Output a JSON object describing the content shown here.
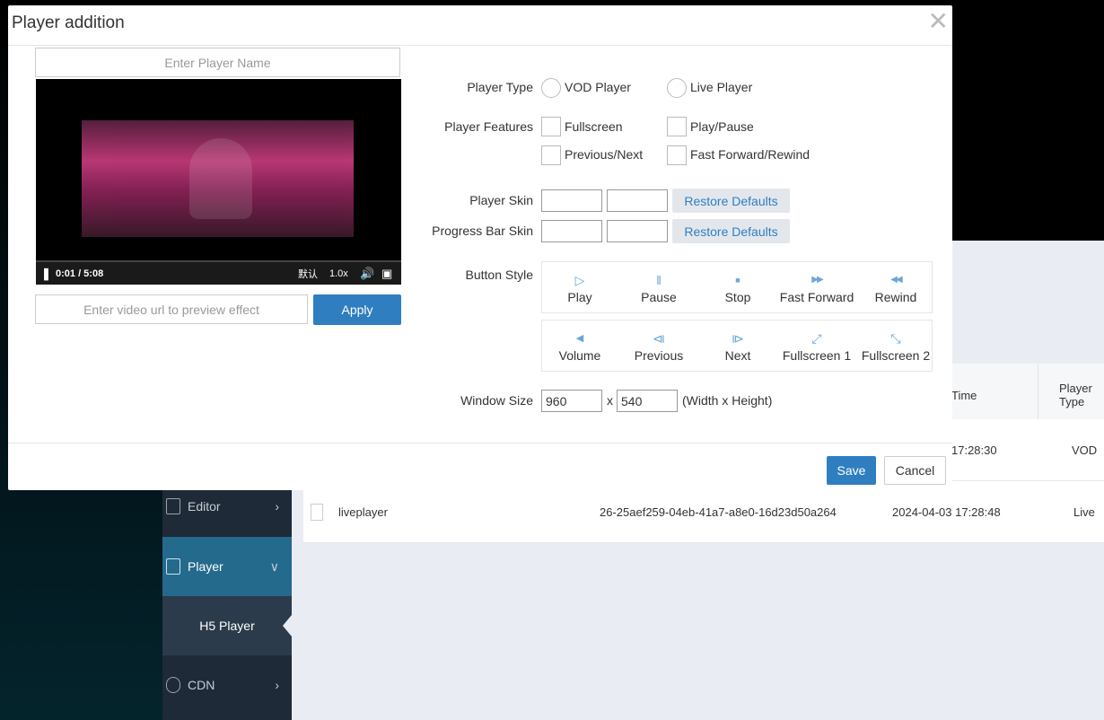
{
  "sidebar": {
    "items": [
      {
        "label": "Editor",
        "icon": "editor-icon",
        "chevron": "›"
      },
      {
        "label": "Player",
        "icon": "player-icon",
        "chevron": "∨"
      },
      {
        "label": "CDN",
        "icon": "cdn-icon",
        "chevron": "›"
      }
    ],
    "sub_item": "H5 Player"
  },
  "table": {
    "headers": [
      "Time",
      "Player Type"
    ],
    "rows": [
      {
        "name": "",
        "id": "",
        "time": "17:28:30",
        "type": "VOD"
      },
      {
        "name": "liveplayer",
        "id": "26-25aef259-04eb-41a7-a8e0-16d23d50a264",
        "time": "2024-04-03 17:28:48",
        "type": "Live"
      }
    ]
  },
  "modal": {
    "title": "Player addition",
    "close": "✕",
    "name_placeholder": "Enter Player Name",
    "url_placeholder": "Enter video url to preview effect",
    "apply_label": "Apply",
    "video": {
      "time": "0:01 / 5:08",
      "quality": "默认",
      "speed": "1.0x"
    },
    "player_type": {
      "label": "Player Type",
      "options": [
        "VOD Player",
        "Live Player"
      ]
    },
    "player_features": {
      "label": "Player Features",
      "options": [
        "Fullscreen",
        "Play/Pause",
        "Previous/Next",
        "Fast Forward/Rewind"
      ]
    },
    "player_skin": {
      "label": "Player Skin",
      "restore": "Restore Defaults"
    },
    "progress_skin": {
      "label": "Progress Bar Skin",
      "restore": "Restore Defaults"
    },
    "button_style": {
      "label": "Button Style",
      "row1": [
        {
          "glyph": "▷",
          "label": "Play",
          "icon": "play-icon"
        },
        {
          "glyph": "‖",
          "label": "Pause",
          "icon": "pause-icon"
        },
        {
          "glyph": "■",
          "label": "Stop",
          "icon": "stop-icon"
        },
        {
          "glyph": "▶▶",
          "label": "Fast Forward",
          "icon": "fast-forward-icon"
        },
        {
          "glyph": "◀◀",
          "label": "Rewind",
          "icon": "rewind-icon"
        }
      ],
      "row2": [
        {
          "glyph": "◀",
          "label": "Volume",
          "icon": "volume-icon"
        },
        {
          "glyph": "⧏",
          "label": "Previous",
          "icon": "previous-icon"
        },
        {
          "glyph": "⧐",
          "label": "Next",
          "icon": "next-icon"
        },
        {
          "glyph": "⤢",
          "label": "Fullscreen 1",
          "icon": "fullscreen-1-icon"
        },
        {
          "glyph": "⤡",
          "label": "Fullscreen 2",
          "icon": "fullscreen-2-icon"
        }
      ]
    },
    "window_size": {
      "label": "Window Size",
      "width": "960",
      "x": "x",
      "height": "540",
      "hint": "(Width x Height)"
    },
    "save_label": "Save",
    "cancel_label": "Cancel"
  }
}
